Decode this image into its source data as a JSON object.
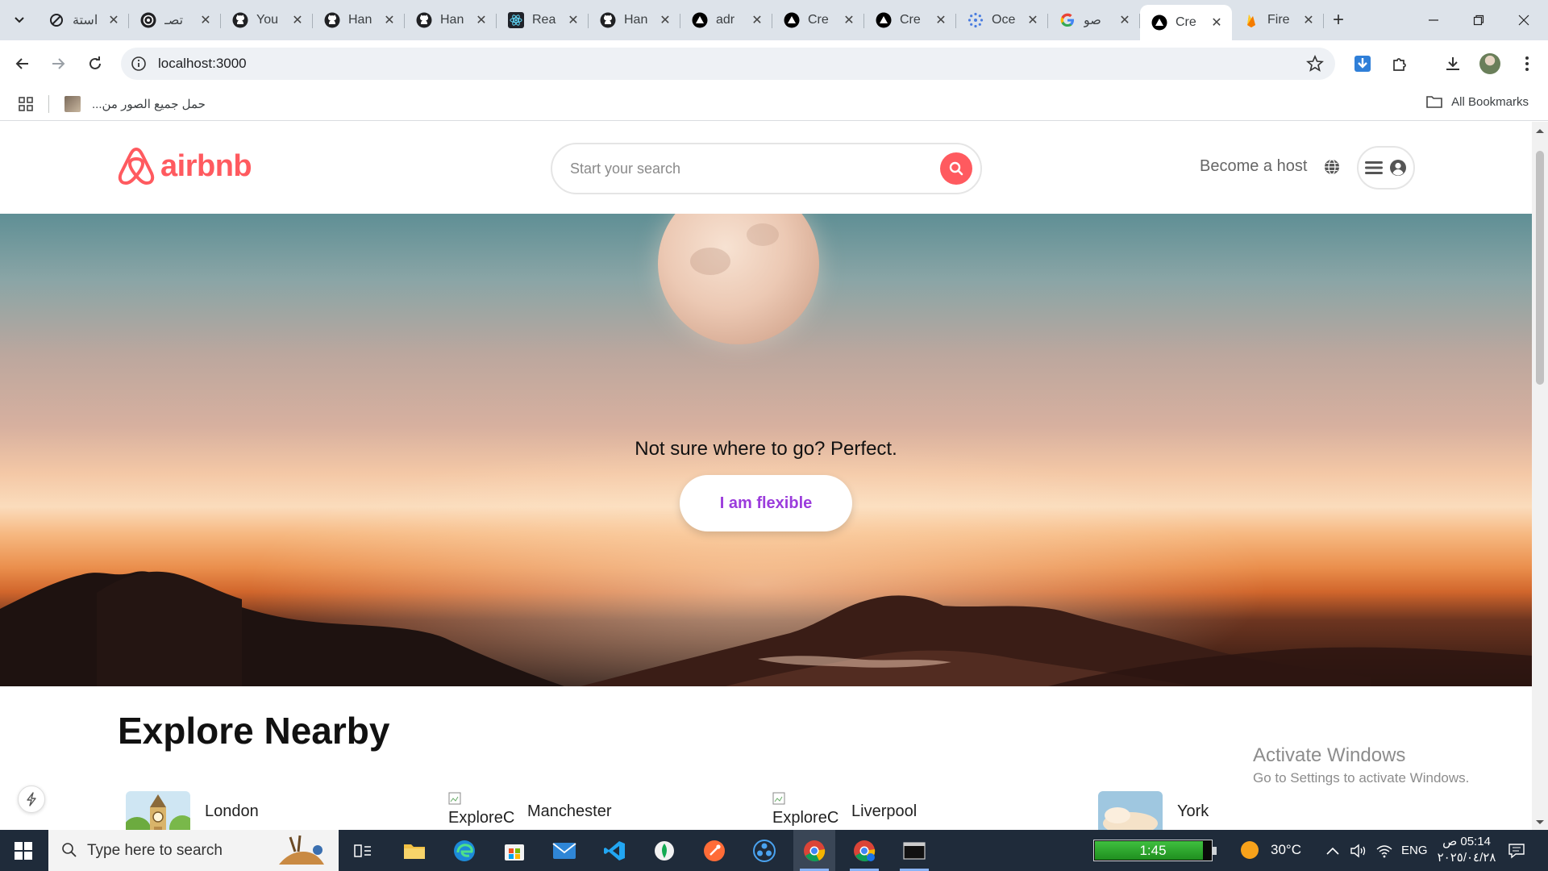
{
  "browser": {
    "tabs": [
      {
        "title": "استة",
        "favicon": "refresh-circle-icon",
        "color": "#202124"
      },
      {
        "title": "تصـ",
        "favicon": "openai-icon",
        "color": "#202124"
      },
      {
        "title": "You",
        "favicon": "github-icon",
        "color": "#202124"
      },
      {
        "title": "Han",
        "favicon": "github-icon",
        "color": "#202124"
      },
      {
        "title": "Han",
        "favicon": "github-icon",
        "color": "#202124"
      },
      {
        "title": "Rea",
        "favicon": "react-icon",
        "color": "#20232a"
      },
      {
        "title": "Han",
        "favicon": "github-icon",
        "color": "#202124"
      },
      {
        "title": "adr",
        "favicon": "triangle-icon",
        "color": "#000000"
      },
      {
        "title": "Cre",
        "favicon": "triangle-icon",
        "color": "#000000"
      },
      {
        "title": "Cre",
        "favicon": "triangle-icon",
        "color": "#000000"
      },
      {
        "title": "Oce",
        "favicon": "dots-circle-icon",
        "color": "#4a7de0"
      },
      {
        "title": "صو",
        "favicon": "google-icon",
        "color": "#ffffff"
      },
      {
        "title": "Cre",
        "favicon": "triangle-icon",
        "color": "#000000",
        "active": true
      },
      {
        "title": "Fire",
        "favicon": "firebase-icon",
        "color": "#ffa000"
      }
    ],
    "url": "localhost:3000",
    "bookmark_label": "حمل جميع الصور من...",
    "all_bookmarks_label": "All Bookmarks"
  },
  "site": {
    "brand": "airbnb",
    "brand_color": "#ff5a5f",
    "search_placeholder": "Start your search",
    "host_label": "Become a host",
    "hero_text": "Not sure where to go? Perfect.",
    "hero_button": "I am flexible",
    "hero_button_color": "#9b3cdc",
    "explore_title": "Explore Nearby",
    "explore_cards": [
      {
        "name": "London",
        "image": "big-ben-icon"
      },
      {
        "name": "Manchester",
        "image_alt": "ExploreC"
      },
      {
        "name": "Liverpool",
        "image_alt": "ExploreC"
      },
      {
        "name": "York",
        "image": "sky-photo"
      }
    ]
  },
  "windows": {
    "activate_title": "Activate Windows",
    "activate_sub": "Go to Settings to activate Windows.",
    "taskbar_search": "Type here to search",
    "battery_time": "1:45",
    "battery_level": 0.92,
    "temperature": "30°C",
    "language": "ENG",
    "clock_time": "05:14 ص",
    "clock_date": "٢٠٢٥/٠٤/٢٨"
  }
}
